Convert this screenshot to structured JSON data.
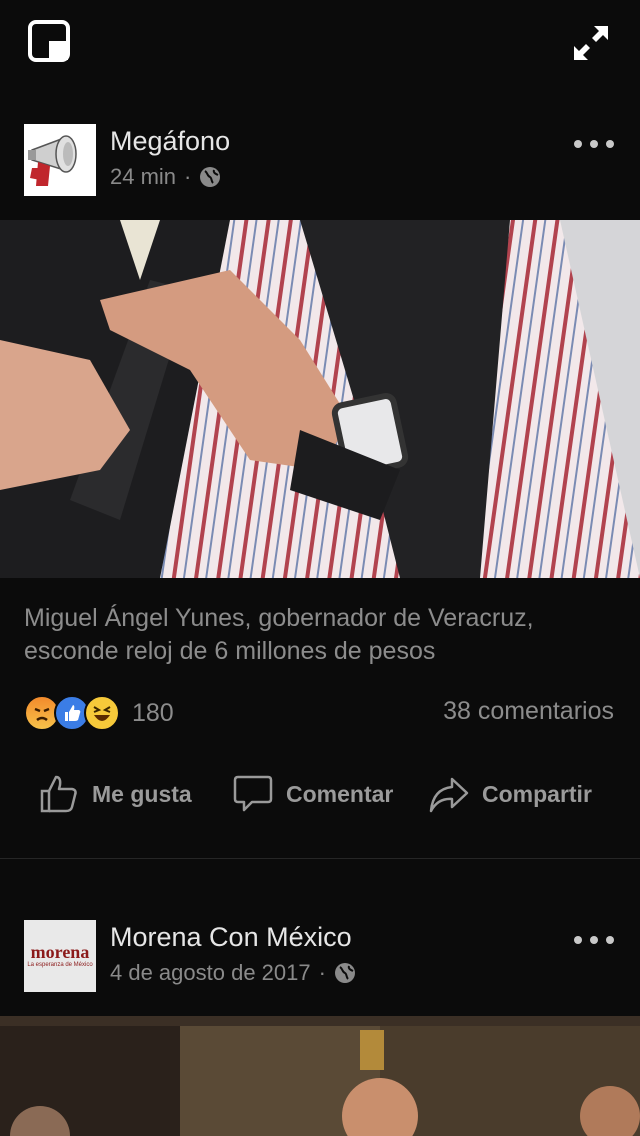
{
  "topbar": {
    "pip_icon": "picture-in-picture-icon",
    "expand_icon": "expand-arrows-icon"
  },
  "posts": [
    {
      "author": "Megáfono",
      "time": "24 min",
      "separator": "·",
      "privacy_icon": "globe-icon",
      "avatar_icon": "megaphone-icon",
      "caption": "Miguel Ángel Yunes, gobernador de Veracruz, esconde reloj de 6 millones de pesos",
      "reactions": [
        "angry-icon",
        "like-icon",
        "haha-icon"
      ],
      "reaction_count": "180",
      "comments": "38 comentarios",
      "actions": {
        "like": "Me gusta",
        "comment": "Comentar",
        "share": "Compartir"
      }
    },
    {
      "author": "Morena Con México",
      "time": "4 de agosto de 2017",
      "separator": "·",
      "privacy_icon": "globe-icon",
      "avatar_text": "morena",
      "avatar_subtext": "La esperanza de México"
    }
  ],
  "colors": {
    "background": "#0b0b0b",
    "text_primary": "#e6e6e6",
    "text_secondary": "#8c8c8c",
    "like_blue": "#3b7de6",
    "morena_red": "#8b1a1a"
  }
}
